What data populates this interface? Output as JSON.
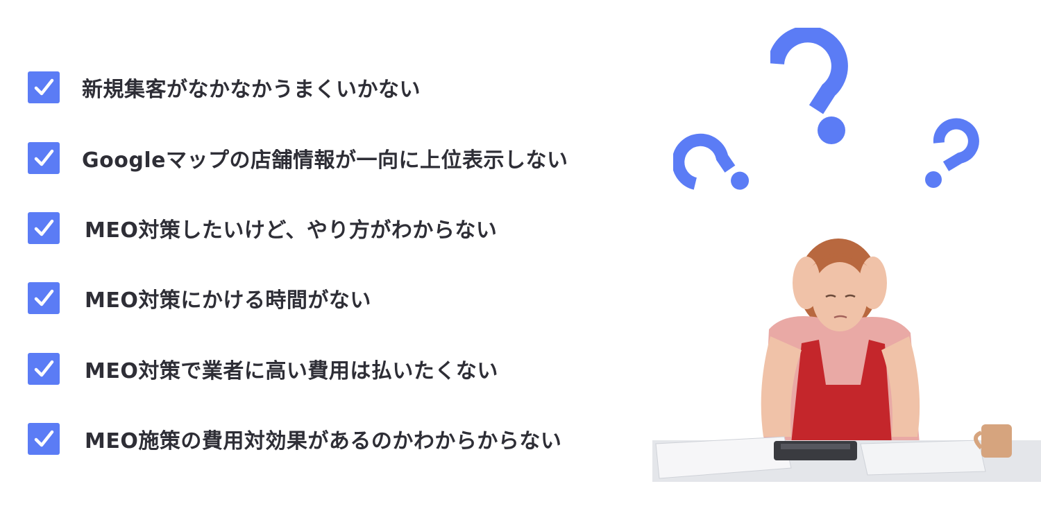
{
  "checklist": {
    "items": [
      {
        "label": "新規集客がなかなかうまくいかない",
        "icon": "checkmark-icon",
        "checked": true
      },
      {
        "label": "Googleマップの店舗情報が一向に上位表示しない",
        "icon": "checkmark-icon",
        "checked": true
      },
      {
        "label": "MEO対策したいけど、やり方がわからない",
        "icon": "checkmark-icon",
        "checked": true
      },
      {
        "label": "MEO対策にかける時間がない",
        "icon": "checkmark-icon",
        "checked": true
      },
      {
        "label": "MEO対策で業者に高い費用は払いたくない",
        "icon": "checkmark-icon",
        "checked": true
      },
      {
        "label": "MEO施策の費用対効果があるのかわからからない",
        "icon": "checkmark-icon",
        "checked": true
      }
    ]
  },
  "illustration": {
    "icons": [
      "question-mark-icon",
      "question-mark-icon",
      "question-mark-icon"
    ],
    "subject": "worried-woman-at-desk"
  },
  "colors": {
    "accent": "#5b7cf5",
    "text": "#2e2e36",
    "apron": "#c4262b",
    "shirt": "#e9a9a5",
    "hair": "#b8683f",
    "skin": "#f0c2a8",
    "desk": "#e4e6ea",
    "mug": "#d6a47e",
    "calculator": "#3a3b40"
  }
}
